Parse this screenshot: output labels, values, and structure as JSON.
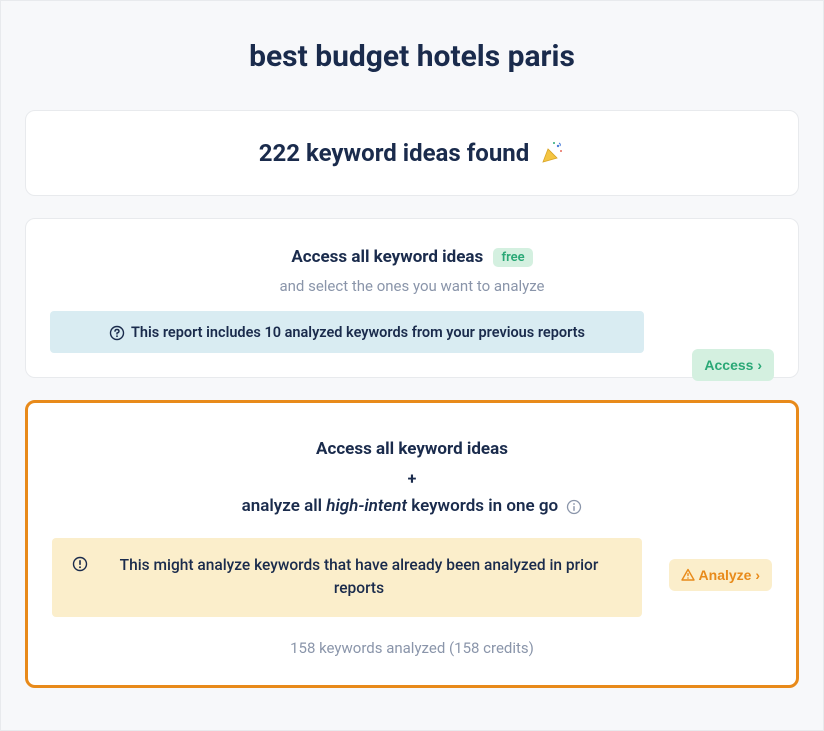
{
  "title": "best budget hotels paris",
  "found_text": "222 keyword ideas found",
  "access_block": {
    "heading": "Access all keyword ideas",
    "badge": "free",
    "sub": "and select the ones you want to analyze",
    "notice": "This report includes 10 analyzed keywords from your previous reports",
    "button": "Access ›"
  },
  "analyze_block": {
    "heading": "Access all keyword ideas",
    "plus": "+",
    "line2_prefix": "analyze all ",
    "line2_em": "high-intent",
    "line2_suffix": " keywords in one go",
    "warning": "This might analyze keywords that have already been analyzed in prior reports",
    "credits": "158 keywords analyzed (158 credits)",
    "button": "Analyze ›"
  }
}
